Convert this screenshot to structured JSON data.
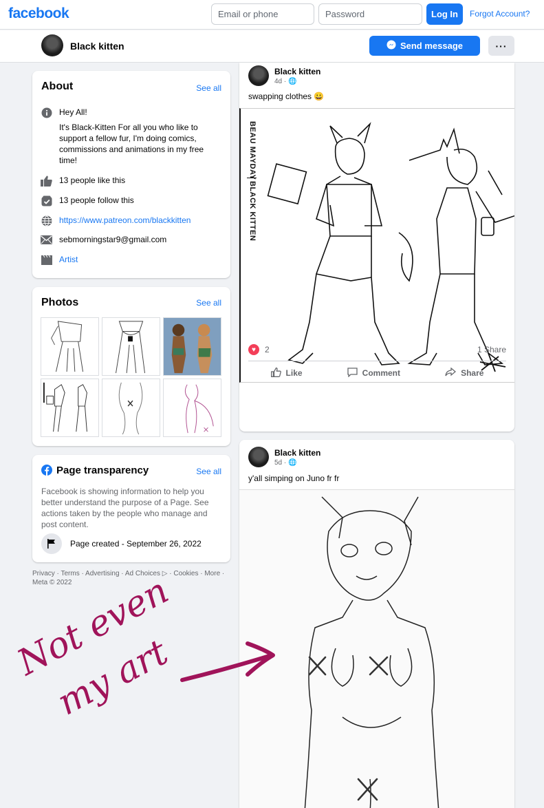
{
  "nav": {
    "logo": "facebook",
    "email_placeholder": "Email or phone",
    "password_placeholder": "Password",
    "login_label": "Log In",
    "forgot_label": "Forgot Account?"
  },
  "page": {
    "name": "Black kitten",
    "send_message_label": "Send message",
    "more_label": "···"
  },
  "about": {
    "title": "About",
    "see_all": "See all",
    "intro_line1": "Hey All!",
    "intro_line2": "It's Black-Kitten For all you who like to support a fellow fur, I'm doing comics, commissions and animations in my free time!",
    "likes": "13 people like this",
    "follows": "13 people follow this",
    "website": "https://www.patreon.com/blackkitten",
    "email": "sebmorningstar9@gmail.com",
    "category": "Artist"
  },
  "photos": {
    "title": "Photos",
    "see_all": "See all"
  },
  "transparency": {
    "title": "Page transparency",
    "see_all": "See all",
    "description": "Facebook is showing information to help you better understand the purpose of a Page. See actions taken by the people who manage and post content.",
    "created": "Page created - September 26, 2022"
  },
  "footer": {
    "links": "Privacy · Terms · Advertising · Ad Choices ▷ · Cookies · More ·",
    "copyright": "Meta © 2022"
  },
  "posts": [
    {
      "author": "Black kitten",
      "time": "4d · 🌐",
      "text": "swapping clothes 😀",
      "reactions_count": "2",
      "shares": "1 Share",
      "image_text_1": "BEAU MAYDAY",
      "image_text_2": "BLACK KITTEN",
      "like_label": "Like",
      "comment_label": "Comment",
      "share_label": "Share"
    },
    {
      "author": "Black kitten",
      "time": "5d · 🌐",
      "text": "y'all simping on Juno fr fr"
    }
  ],
  "annotation": {
    "line1": "Not even",
    "line2": "my art"
  },
  "colors": {
    "brand_blue": "#1877f2",
    "background": "#f0f2f5",
    "annotation_magenta": "#a0145a"
  }
}
